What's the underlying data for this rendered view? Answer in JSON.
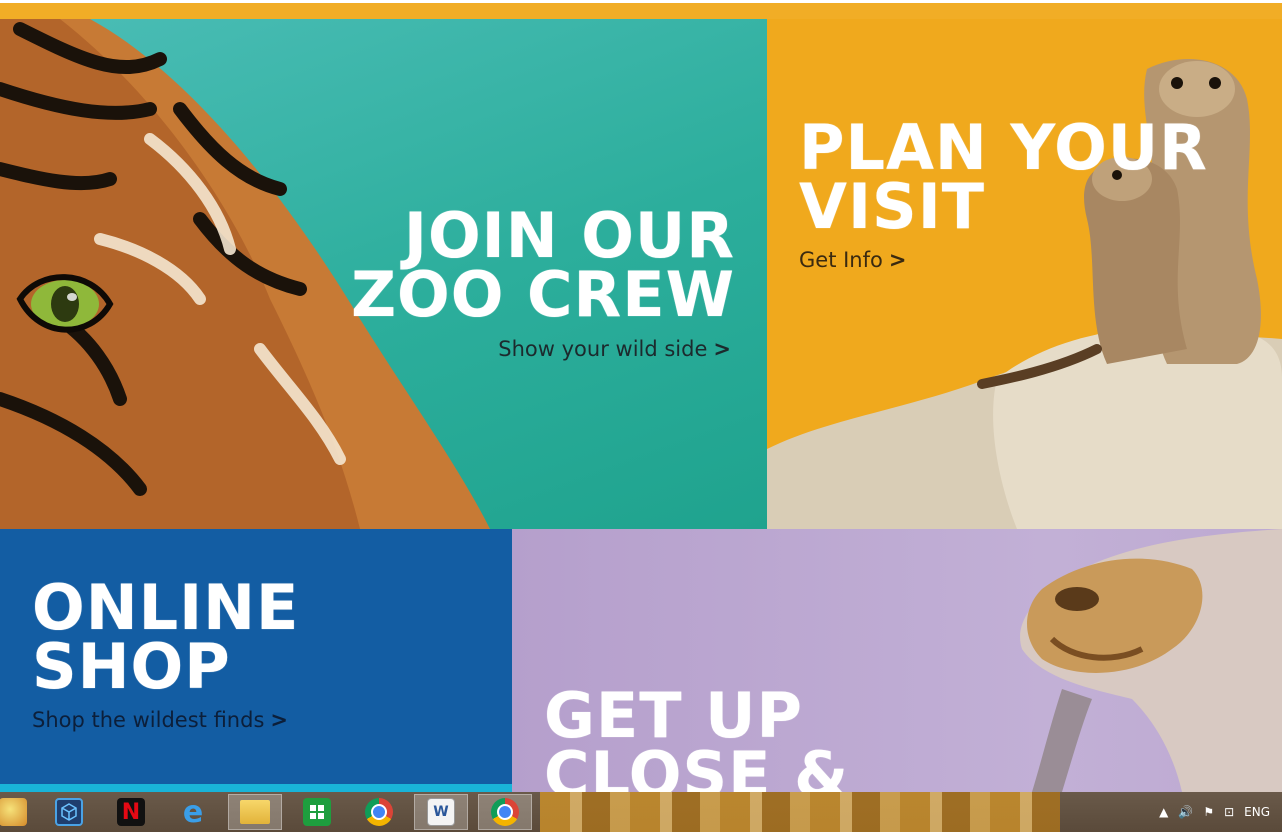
{
  "tiles": {
    "crew": {
      "title_line1": "JOIN OUR",
      "title_line2": "ZOO CREW",
      "link": "Show your wild side"
    },
    "visit": {
      "title_line1": "PLAN YOUR",
      "title_line2": "VISIT",
      "link": "Get Info"
    },
    "shop": {
      "title_line1": "ONLINE",
      "title_line2": "SHOP",
      "link": "Shop the wildest finds"
    },
    "close": {
      "title_line1": "GET UP",
      "title_line2": "CLOSE &"
    }
  },
  "chevron": ">",
  "colors": {
    "crew_bg": "#2cae9c",
    "visit_bg": "#f0a91d",
    "shop_bg": "#135da3",
    "close_bg": "#bda9d1",
    "top_stripe": "#f1ad26"
  },
  "taskbar": {
    "apps": [
      {
        "name": "paint-icon"
      },
      {
        "name": "app-cube-icon"
      },
      {
        "name": "netflix-icon",
        "label": "N"
      },
      {
        "name": "internet-explorer-icon",
        "label": "e"
      },
      {
        "name": "file-explorer-icon"
      },
      {
        "name": "store-icon"
      },
      {
        "name": "chrome-icon"
      },
      {
        "name": "word-icon",
        "label": "W"
      },
      {
        "name": "chrome-profile-icon"
      }
    ],
    "language": "ENG"
  }
}
